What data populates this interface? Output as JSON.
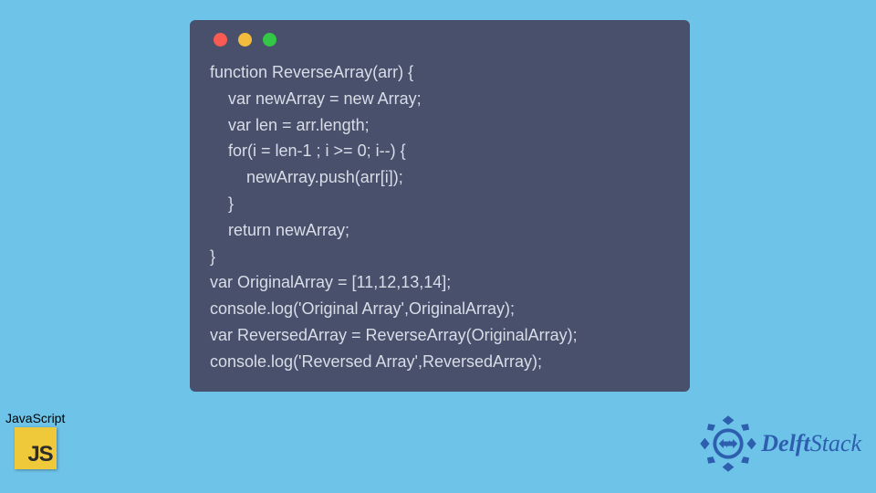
{
  "code": {
    "lines": [
      "function ReverseArray(arr) {",
      "    var newArray = new Array;",
      "    var len = arr.length;",
      "    for(i = len-1 ; i >= 0; i--) {",
      "        newArray.push(arr[i]);",
      "    }",
      "    return newArray;",
      "}",
      "var OriginalArray = [11,12,13,14];",
      "console.log('Original Array',OriginalArray);",
      "var ReversedArray = ReverseArray(OriginalArray);",
      "console.log('Reversed Array',ReversedArray);"
    ]
  },
  "js_badge": {
    "label": "JavaScript",
    "logo_text": "JS"
  },
  "delft": {
    "brand_bold": "Delft",
    "brand_rest": "Stack"
  },
  "colors": {
    "bg": "#6ec3e9",
    "window": "#48506b",
    "code_text": "#d9dde8",
    "dot_red": "#f95b54",
    "dot_yellow": "#f2bd3c",
    "dot_green": "#34c647",
    "js_bg": "#f0c93a",
    "delft_blue": "#2d5fae"
  }
}
